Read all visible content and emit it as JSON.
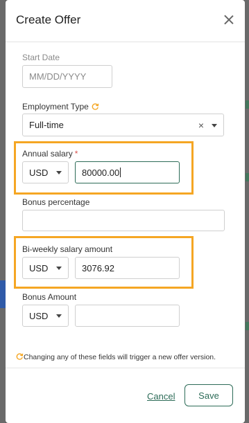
{
  "modal": {
    "title": "Create Offer"
  },
  "start_date": {
    "label": "Start Date",
    "placeholder": "MM/DD/YYYY"
  },
  "employment_type": {
    "label": "Employment Type",
    "value": "Full-time",
    "clear_glyph": "×"
  },
  "annual_salary": {
    "label": "Annual salary",
    "required_marker": "*",
    "currency": "USD",
    "value": "80000.00"
  },
  "bonus_percentage": {
    "label": "Bonus percentage",
    "value": ""
  },
  "biweekly_salary": {
    "label": "Bi-weekly salary amount",
    "currency": "USD",
    "value": "3076.92"
  },
  "bonus_amount": {
    "label": "Bonus Amount",
    "currency": "USD",
    "value": ""
  },
  "note": "Changing any of these fields will trigger a new offer version.",
  "actions": {
    "cancel": "Cancel",
    "save": "Save"
  },
  "colors": {
    "accent": "#2c6b57",
    "highlight": "#f5a623",
    "icon_orange": "#f5a623",
    "required": "#d9534f"
  }
}
